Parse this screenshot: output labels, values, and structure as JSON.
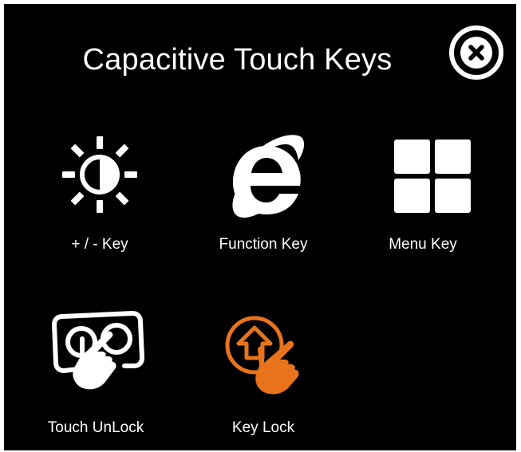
{
  "window": {
    "title": "Capacitive Touch Keys",
    "close_icon": "close-x-circle-icon",
    "background": "#000000",
    "foreground": "#ffffff",
    "accent": "#e8731a"
  },
  "keys": [
    {
      "label": "+ / -  Key",
      "icon": "brightness-icon"
    },
    {
      "label": "Function Key",
      "icon": "internet-explorer-icon"
    },
    {
      "label": "Menu Key",
      "icon": "four-squares-menu-icon"
    },
    {
      "label": "Touch UnLock",
      "icon": "touch-unlock-hand-icon"
    },
    {
      "label": "Key Lock",
      "icon": "key-lock-hand-icon"
    }
  ]
}
